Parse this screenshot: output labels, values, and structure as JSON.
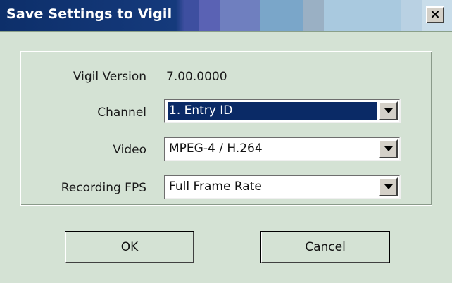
{
  "window": {
    "title": "Save Settings to Vigil",
    "close_symbol": "×"
  },
  "form": {
    "version_label": "Vigil Version",
    "version_value": "7.00.0000",
    "channel_label": "Channel",
    "channel_value": "1. Entry ID",
    "video_label": "Video",
    "video_value": "MPEG-4 / H.264",
    "fps_label": "Recording FPS",
    "fps_value": "Full Frame Rate"
  },
  "buttons": {
    "ok": "OK",
    "cancel": "Cancel"
  },
  "colors": {
    "title_bar_start": "#0d2f6a",
    "dialog_background": "#d4e2d4",
    "selection_highlight": "#0a2a66"
  }
}
